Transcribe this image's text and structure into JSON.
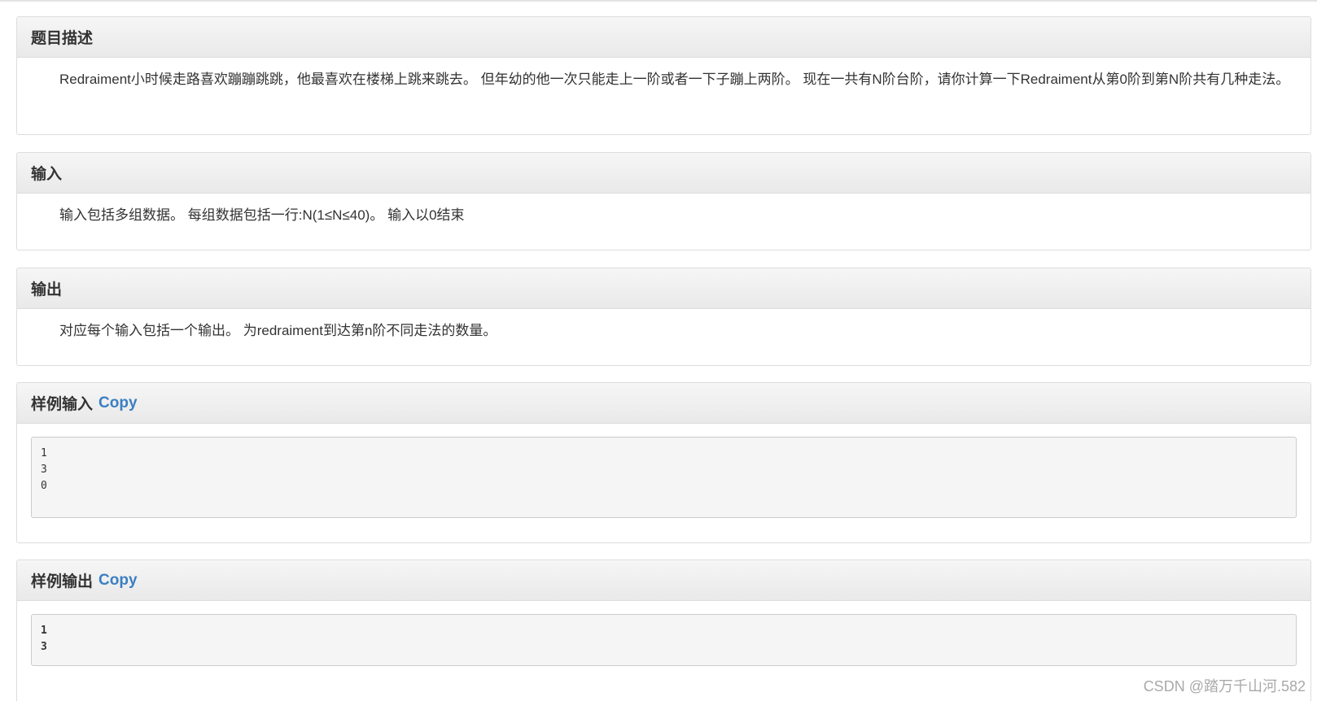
{
  "sections": {
    "description": {
      "title": "题目描述",
      "text": "Redraiment小时候走路喜欢蹦蹦跳跳，他最喜欢在楼梯上跳来跳去。 但年幼的他一次只能走上一阶或者一下子蹦上两阶。 现在一共有N阶台阶，请你计算一下Redraiment从第0阶到第N阶共有几种走法。"
    },
    "input": {
      "title": "输入",
      "text": "输入包括多组数据。 每组数据包括一行:N(1≤N≤40)。 输入以0结束"
    },
    "output": {
      "title": "输出",
      "text": "对应每个输入包括一个输出。 为redraiment到达第n阶不同走法的数量。"
    },
    "sample_input": {
      "title": "样例输入",
      "copy_label": "Copy",
      "content": "1\n3\n0"
    },
    "sample_output": {
      "title": "样例输出",
      "copy_label": "Copy",
      "content": "1\n3"
    }
  },
  "watermark": "CSDN @踏万千山河.582",
  "colors": {
    "link": "#3b7fc2",
    "heading_bg": "#eeeeee",
    "border": "#dddddd"
  }
}
